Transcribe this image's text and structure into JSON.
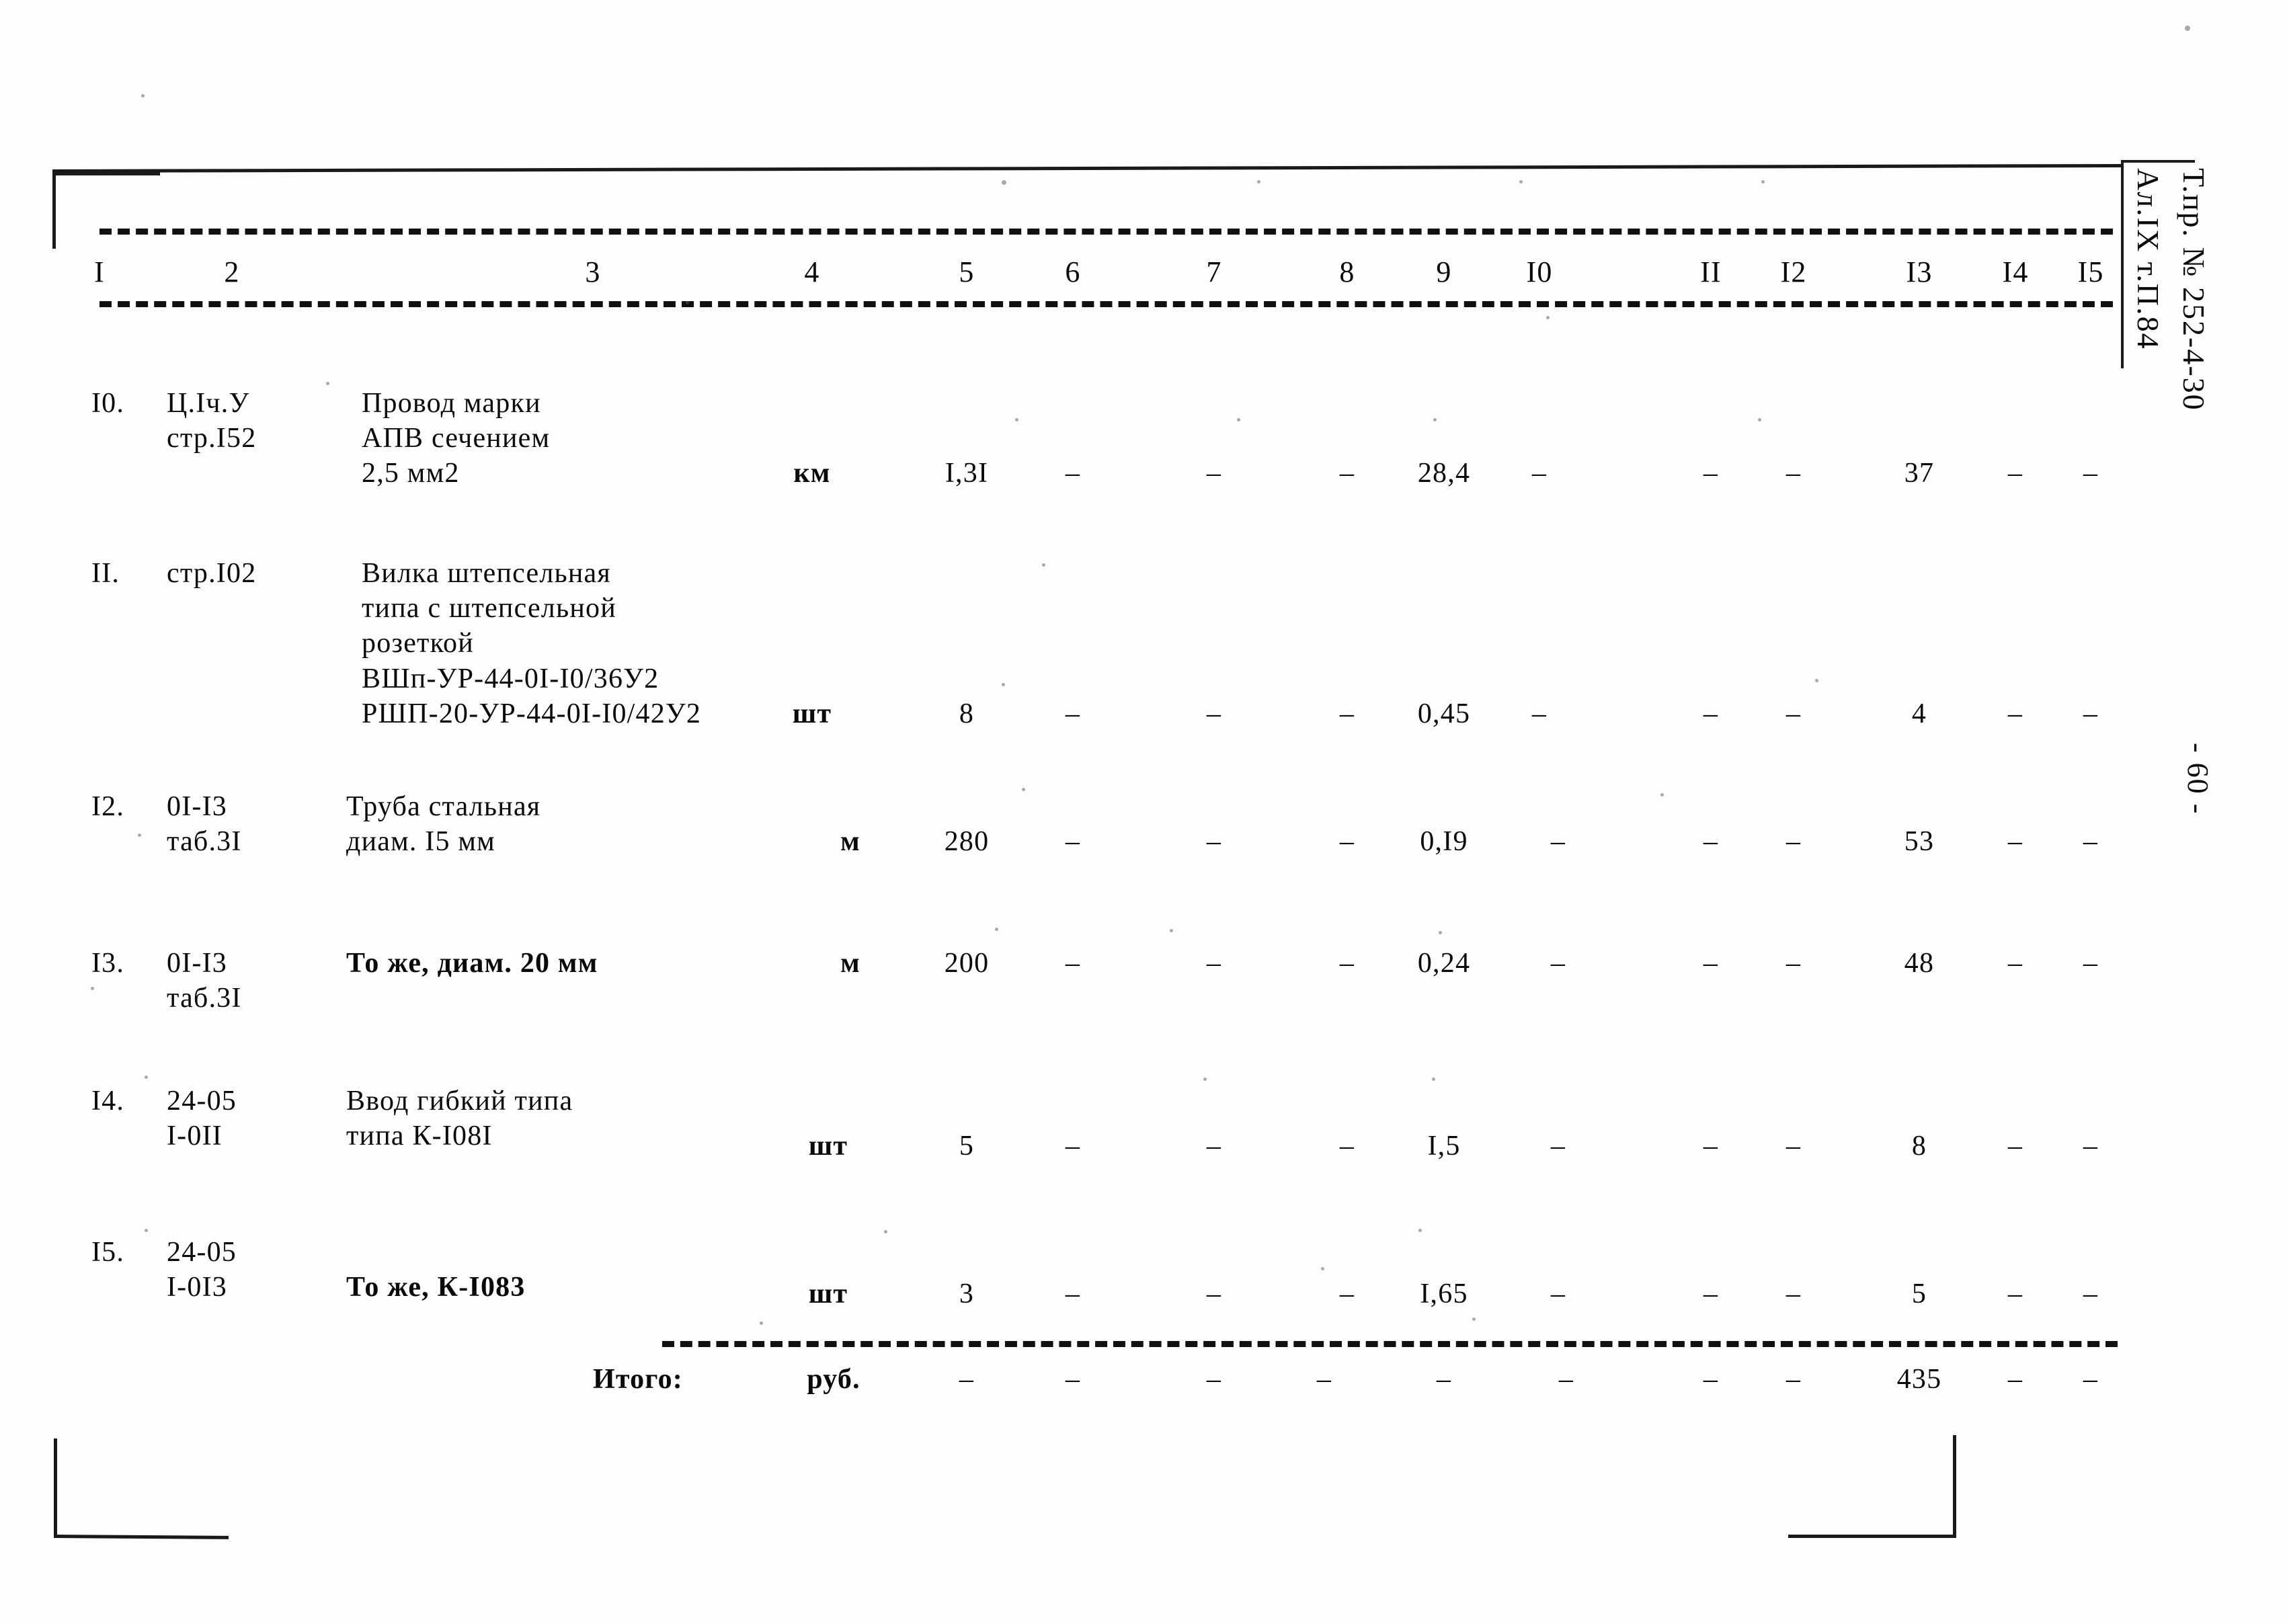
{
  "document": {
    "side_stamp_line1": "Т.пр. № 252-4-30",
    "side_stamp_line2": "Ал.IX т.П.84",
    "page_marker": "- 60 -"
  },
  "table": {
    "column_headers": [
      "I",
      "2",
      "3",
      "4",
      "5",
      "6",
      "7",
      "8",
      "9",
      "I0",
      "II",
      "I2",
      "I3",
      "I4",
      "I5"
    ],
    "rows": [
      {
        "no": "I0.",
        "code_lines": [
          "Ц.Iч.У",
          "стр.I52"
        ],
        "name_lines": [
          "Провод марки",
          "АПВ сечением",
          "2,5 мм2"
        ],
        "unit": "км",
        "c5": "I,3I",
        "c6": "–",
        "c7": "–",
        "c8": "–",
        "c9": "28,4",
        "c10": "–",
        "c11": "–",
        "c12": "–",
        "c13": "37",
        "c14": "–",
        "c15": "–"
      },
      {
        "no": "II.",
        "code_lines": [
          "стр.I02"
        ],
        "name_lines": [
          "Вилка штепсельная",
          "типа с штепсельной",
          "розеткой",
          "ВШп-УР-44-0I-I0/36У2",
          "РШП-20-УР-44-0I-I0/42У2"
        ],
        "unit": "шт",
        "c5": "8",
        "c6": "–",
        "c7": "–",
        "c8": "–",
        "c9": "0,45",
        "c10": "–",
        "c11": "–",
        "c12": "–",
        "c13": "4",
        "c14": "–",
        "c15": "–"
      },
      {
        "no": "I2.",
        "code_lines": [
          "0I-I3",
          "таб.3I"
        ],
        "name_lines": [
          "Труба стальная",
          "диам. I5 мм"
        ],
        "unit": "м",
        "c5": "280",
        "c6": "–",
        "c7": "–",
        "c8": "–",
        "c9": "0,I9",
        "c10": "–",
        "c11": "–",
        "c12": "–",
        "c13": "53",
        "c14": "–",
        "c15": "–"
      },
      {
        "no": "I3.",
        "code_lines": [
          "0I-I3",
          "таб.3I"
        ],
        "name_lines": [
          "То же, диам. 20 мм"
        ],
        "unit": "м",
        "c5": "200",
        "c6": "–",
        "c7": "–",
        "c8": "–",
        "c9": "0,24",
        "c10": "–",
        "c11": "–",
        "c12": "–",
        "c13": "48",
        "c14": "–",
        "c15": "–"
      },
      {
        "no": "I4.",
        "code_lines": [
          "24-05",
          "I-0II"
        ],
        "name_lines": [
          "Ввод гибкий типа",
          "типа К-I08I"
        ],
        "unit": "шт",
        "c5": "5",
        "c6": "–",
        "c7": "–",
        "c8": "–",
        "c9": "I,5",
        "c10": "–",
        "c11": "–",
        "c12": "–",
        "c13": "8",
        "c14": "–",
        "c15": "–"
      },
      {
        "no": "I5.",
        "code_lines": [
          "24-05",
          "I-0I3"
        ],
        "name_lines": [
          "То же, К-I083"
        ],
        "unit": "шт",
        "c5": "3",
        "c6": "–",
        "c7": "–",
        "c8": "–",
        "c9": "I,65",
        "c10": "–",
        "c11": "–",
        "c12": "–",
        "c13": "5",
        "c14": "–",
        "c15": "–"
      }
    ],
    "total_row": {
      "label": "Итого:",
      "unit": "руб.",
      "c5": "–",
      "c6": "–",
      "c7": "–",
      "c8": "–",
      "c9": "–",
      "c10": "–",
      "c11": "–",
      "c12": "–",
      "c13": "435",
      "c14": "–",
      "c15": "–"
    }
  }
}
